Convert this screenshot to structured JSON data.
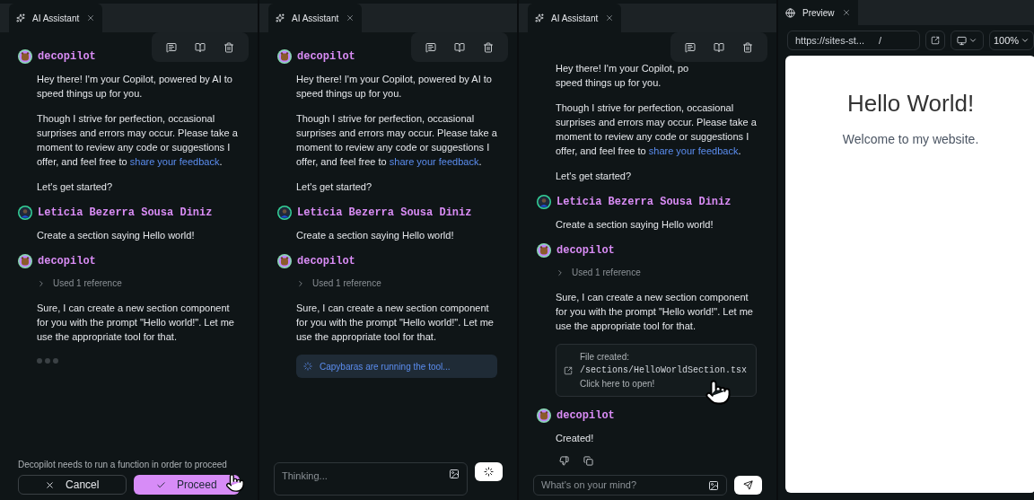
{
  "chat_panels": [
    {
      "tab": {
        "label": "AI Assistant"
      },
      "messages": [
        {
          "author": "decopilot",
          "kind": "bot",
          "blocks": [
            {
              "kind": "text",
              "text": "Hey there! I'm your Copilot, powered by AI to speed things up for you."
            },
            {
              "kind": "text",
              "text": "Though I strive for perfection, occasional surprises and errors may occur. Please take a moment to review any code or suggestions I offer, and feel free to ",
              "link": "share your feedback",
              "tail": "."
            },
            {
              "kind": "text",
              "text": "Let's get started?"
            }
          ]
        },
        {
          "author": "Leticia Bezerra Sousa Diniz",
          "kind": "user",
          "blocks": [
            {
              "kind": "text",
              "text": "Create a section saying Hello world!"
            }
          ]
        },
        {
          "author": "decopilot",
          "kind": "bot",
          "blocks": [
            {
              "kind": "reference",
              "label": "Used 1 reference",
              "expanded": false
            },
            {
              "kind": "text",
              "text": "Sure, I can create a new section component for you with the prompt \"Hello world!\". Let me use the appropriate tool for that."
            },
            {
              "kind": "typing"
            }
          ]
        }
      ],
      "footer": {
        "kind": "confirm",
        "note": "Decopilot needs to run a function in order to proceed",
        "cancel": "Cancel",
        "proceed": "Proceed"
      }
    },
    {
      "tab": {
        "label": "AI Assistant"
      },
      "messages": [
        {
          "author": "decopilot",
          "kind": "bot",
          "blocks": [
            {
              "kind": "text",
              "text": "Hey there! I'm your Copilot, powered by AI to speed things up for you."
            },
            {
              "kind": "text",
              "text": "Though I strive for perfection, occasional surprises and errors may occur. Please take a moment to review any code or suggestions I offer, and feel free to ",
              "link": "share your feedback",
              "tail": "."
            },
            {
              "kind": "text",
              "text": "Let's get started?"
            }
          ]
        },
        {
          "author": "Leticia Bezerra Sousa Diniz",
          "kind": "user",
          "blocks": [
            {
              "kind": "text",
              "text": "Create a section saying Hello world!"
            }
          ]
        },
        {
          "author": "decopilot",
          "kind": "bot",
          "blocks": [
            {
              "kind": "reference",
              "label": "Used 1 reference",
              "expanded": false
            },
            {
              "kind": "text",
              "text": "Sure, I can create a new section component for you with the prompt \"Hello world!\". Let me use the appropriate tool for that."
            },
            {
              "kind": "tool_status",
              "text": "Capybaras are running the tool..."
            }
          ]
        }
      ],
      "footer": {
        "kind": "input",
        "placeholder": "Thinking...",
        "busy": true
      }
    },
    {
      "tab": {
        "label": "AI Assistant"
      },
      "messages": [
        {
          "blocks": [
            {
              "kind": "lines",
              "lines": [
                "Hey there! I'm your Copilot, po",
                "speed things up for you."
              ]
            },
            {
              "kind": "text",
              "text": "Though I strive for perfection, occasional surprises and errors may occur. Please take a moment to review any code or suggestions I offer, and feel free to ",
              "link": "share your feedback",
              "tail": "."
            },
            {
              "kind": "text",
              "text": "Let's get started?"
            }
          ]
        },
        {
          "author": "Leticia Bezerra Sousa Diniz",
          "kind": "user",
          "blocks": [
            {
              "kind": "text",
              "text": "Create a section saying Hello world!"
            }
          ]
        },
        {
          "author": "decopilot",
          "kind": "bot",
          "blocks": [
            {
              "kind": "reference",
              "label": "Used 1 reference",
              "expanded": false
            },
            {
              "kind": "text",
              "text": "Sure, I can create a new section component for you with the prompt \"Hello world!\". Let me use the appropriate tool for that."
            },
            {
              "kind": "file_card",
              "title": "File created:",
              "path": "/sections/HelloWorldSection.tsx",
              "action": "Click here to open!"
            }
          ]
        },
        {
          "author": "decopilot",
          "kind": "bot",
          "blocks": [
            {
              "kind": "text",
              "text": "Created!"
            },
            {
              "kind": "actions"
            }
          ]
        }
      ],
      "footer": {
        "kind": "input",
        "placeholder": "What's on your mind?",
        "busy": false
      }
    }
  ],
  "preview": {
    "tab": {
      "label": "Preview"
    },
    "url": "https://sites-st...",
    "path": "/",
    "zoom": "100%",
    "page": {
      "heading": "Hello World!",
      "subtitle": "Welcome to my website."
    }
  }
}
